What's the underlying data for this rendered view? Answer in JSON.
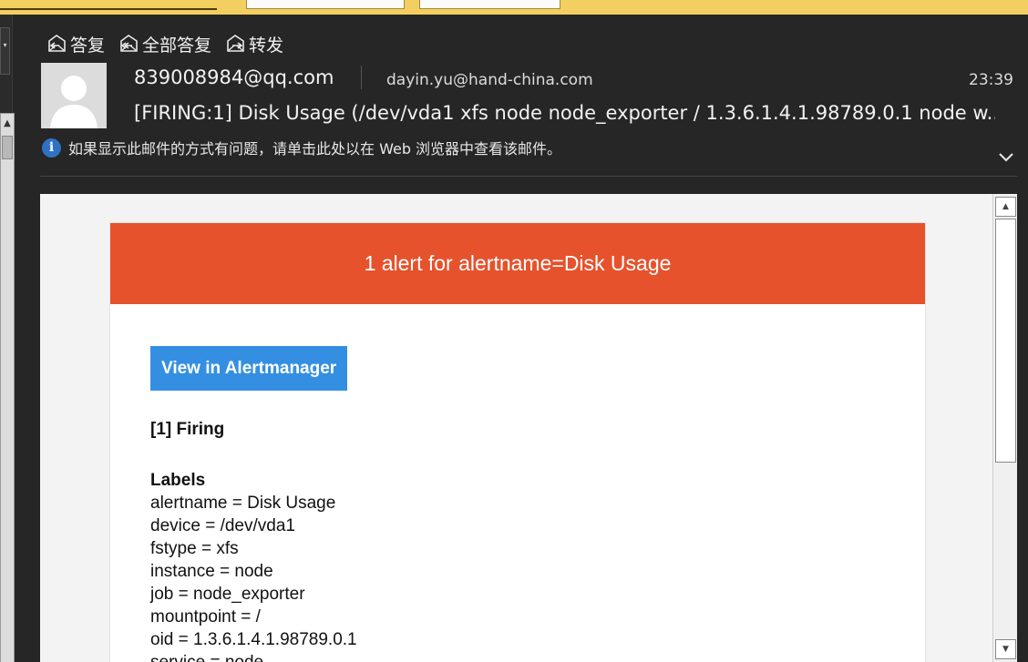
{
  "toolbar": {
    "reply": "答复",
    "reply_all": "全部答复",
    "forward": "转发"
  },
  "message": {
    "from": "839008984@qq.com",
    "to": "dayin.yu@hand-china.com",
    "time": "23:39",
    "subject": "[FIRING:1] Disk Usage (/dev/vda1 xfs node node_exporter / 1.3.6.1.4.1.98789.0.1 node w...",
    "notice": "如果显示此邮件的方式有问题，请单击此处以在 Web 浏览器中查看该邮件。"
  },
  "alert": {
    "header": "1 alert for alertname=Disk Usage",
    "button": "View in Alertmanager",
    "firing": "[1] Firing",
    "labels_title": "Labels",
    "labels": [
      "alertname = Disk Usage",
      "device = /dev/vda1",
      "fstype = xfs",
      "instance = node",
      "job = node_exporter",
      "mountpoint = /",
      "oid = 1.3.6.1.4.1.98789.0.1",
      "service = node"
    ]
  },
  "colors": {
    "alert_header": "#e6522c",
    "button": "#348fe2",
    "background": "#262626",
    "infobar": "#f2cf60"
  },
  "icons": {
    "reply": "reply-icon",
    "reply_all": "reply-all-icon",
    "forward": "forward-icon",
    "info": "info-icon",
    "expand": "chevron-down-icon"
  }
}
